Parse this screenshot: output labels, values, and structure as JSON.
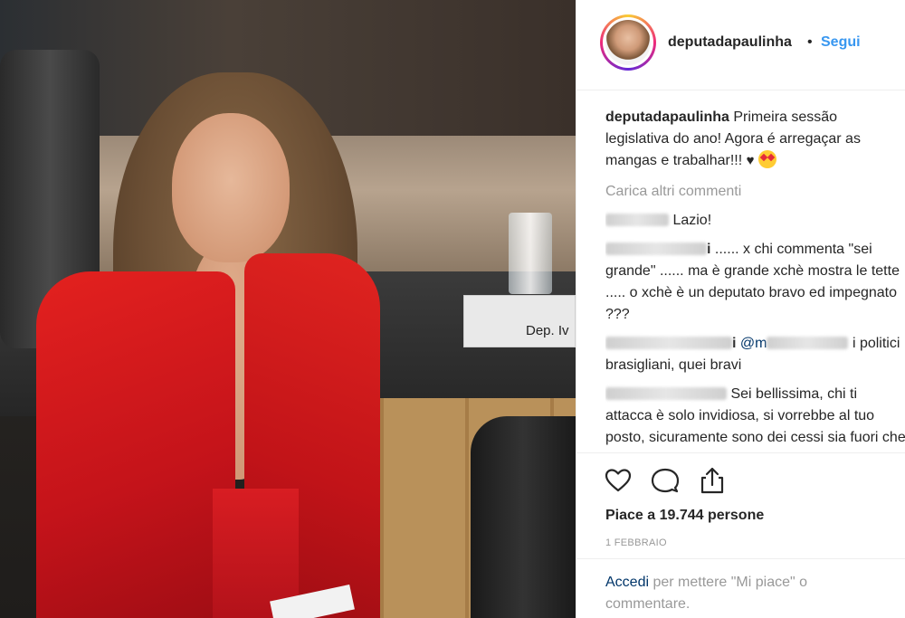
{
  "photo": {
    "nameplate_text": "Dep. Iv"
  },
  "header": {
    "username": "deputadapaulinha",
    "separator": "•",
    "follow_label": "Segui"
  },
  "caption": {
    "username": "deputadapaulinha",
    "text": "Primeira sessão legislativa do ano! Agora é arregaçar as mangas e trabalhar!!!",
    "heart": "♥"
  },
  "load_more_label": "Carica altri commenti",
  "comments": [
    {
      "username_suffix": "",
      "text": "Lazio!"
    },
    {
      "username_suffix": "i",
      "text": "...... x chi commenta \"sei grande\" ...... ma è grande xchè mostra le tette ..... o xchè è un deputato bravo ed impegnato ???"
    },
    {
      "username_suffix": "i",
      "mention_prefix": "@m",
      "text": "i politici brasigliani, quei bravi"
    },
    {
      "username_suffix": "",
      "text": "Sei bellissima, chi ti attacca è solo invidiosa, si vorrebbe al tuo posto, sicuramente sono dei cessi sia fuori che dentro... W... D... mil..."
    }
  ],
  "actions": {
    "like_icon": "heart-icon",
    "comment_icon": "comment-icon",
    "share_icon": "share-icon"
  },
  "likes": {
    "prefix": "Piace a ",
    "count": "19.744",
    "suffix": " persone"
  },
  "date": "1 FEBBRAIO",
  "login": {
    "link": "Accedi",
    "text": " per mettere \"Mi piace\" o commentare."
  },
  "colors": {
    "link_blue": "#3897f0",
    "dark_link": "#003569",
    "muted": "#999999",
    "text": "#262626"
  }
}
